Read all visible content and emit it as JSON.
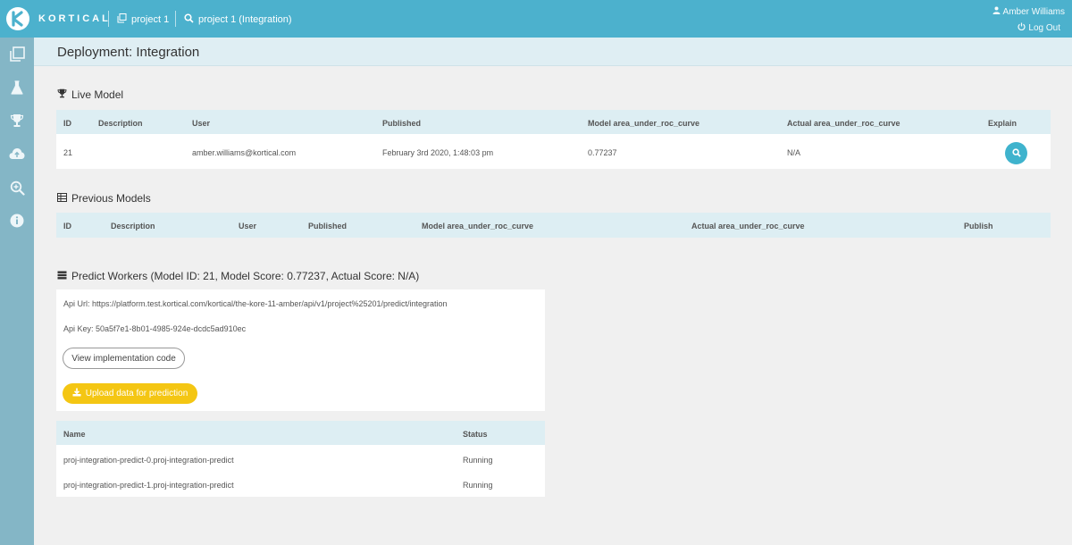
{
  "brand": {
    "name": "KORTICAL"
  },
  "breadcrumb": {
    "project": "project 1",
    "deployment": "project 1 (Integration)"
  },
  "user": {
    "name": "Amber Williams",
    "logout_label": "Log Out"
  },
  "page": {
    "title": "Deployment: Integration"
  },
  "live_model": {
    "title": "Live Model",
    "columns": [
      "ID",
      "Description",
      "User",
      "Published",
      "Model area_under_roc_curve",
      "Actual area_under_roc_curve",
      "Explain"
    ],
    "row": {
      "id": "21",
      "description": "",
      "user": "amber.williams@kortical.com",
      "published": "February 3rd 2020, 1:48:03 pm",
      "model_score": "0.77237",
      "actual_score": "N/A"
    }
  },
  "previous_models": {
    "title": "Previous Models",
    "columns": [
      "ID",
      "Description",
      "User",
      "Published",
      "Model area_under_roc_curve",
      "Actual area_under_roc_curve",
      "Publish"
    ]
  },
  "predict_workers": {
    "title": "Predict Workers (Model ID: 21, Model Score: 0.77237, Actual Score: N/A)",
    "api_url": "Api Url: https://platform.test.kortical.com/kortical/the-kore-11-amber/api/v1/project%25201/predict/integration",
    "api_key": "Api Key: 50a5f7e1-8b01-4985-924e-dcdc5ad910ec",
    "view_code_label": "View implementation code",
    "upload_label": "Upload data for prediction",
    "columns": [
      "Name",
      "Status"
    ],
    "rows": [
      {
        "name": "proj-integration-predict-0.proj-integration-predict",
        "status": "Running"
      },
      {
        "name": "proj-integration-predict-1.proj-integration-predict",
        "status": "Running"
      }
    ]
  },
  "colors": {
    "topbar": "#4cb1cd",
    "sidebar": "#84b6c6",
    "table_header": "#ddeef3",
    "accent": "#3fb3cd",
    "upload": "#f4c613"
  },
  "icons": {
    "sidebar": [
      "projects-icon",
      "flask-icon",
      "trophy-icon",
      "cloud-upload-icon",
      "zoom-icon",
      "info-icon"
    ],
    "section": [
      "trophy-icon",
      "table-icon",
      "server-icon"
    ]
  }
}
